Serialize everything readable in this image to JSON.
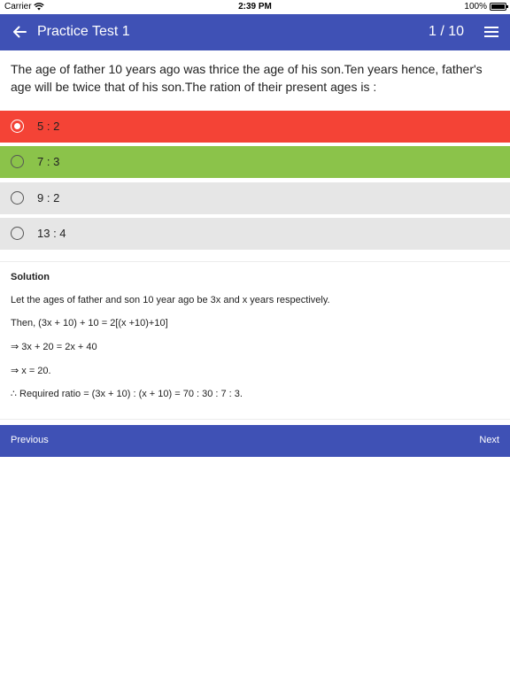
{
  "status_bar": {
    "carrier": "Carrier",
    "time": "2:39 PM",
    "battery": "100%"
  },
  "app_bar": {
    "back_icon": "arrow-left-icon",
    "title": "Practice Test 1",
    "counter": "1 / 10",
    "menu_icon": "hamburger-menu-icon"
  },
  "question": {
    "text": "The age of father 10 years ago was thrice the age of his son.Ten years hence, father's age will be twice that of his son.The ration of their present ages is :"
  },
  "options": [
    {
      "label": "5 : 2",
      "selected": true,
      "state": "wrong",
      "color": "#f44336"
    },
    {
      "label": "7 : 3",
      "selected": false,
      "state": "correct",
      "color": "#8bc34a"
    },
    {
      "label": "9 : 2",
      "selected": false,
      "state": "neutral",
      "color": "#e6e6e6"
    },
    {
      "label": "13 : 4",
      "selected": false,
      "state": "neutral",
      "color": "#e6e6e6"
    }
  ],
  "solution": {
    "heading": "Solution",
    "lines": [
      "Let the ages of father and son 10 year ago be 3x and x years respectively.",
      "Then, (3x + 10) + 10 = 2[(x +10)+10]",
      "⇒ 3x + 20 = 2x + 40",
      "⇒ x = 20.",
      "∴ Required ratio = (3x + 10) : (x + 10) = 70 : 30 : 7 : 3."
    ]
  },
  "navigation": {
    "previous_label": "Previous",
    "next_label": "Next"
  },
  "colors": {
    "primary": "#3f51b5",
    "wrong": "#f44336",
    "correct": "#8bc34a",
    "neutral": "#e6e6e6"
  }
}
